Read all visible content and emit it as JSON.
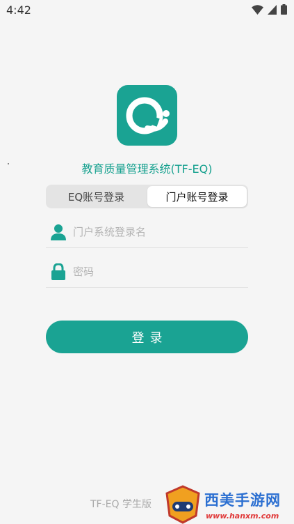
{
  "status_bar": {
    "time": "4:42"
  },
  "app": {
    "title": "教育质量管理系统(TF-EQ)",
    "logo_icon": "app-logo-q-icon",
    "brand_color": "#1aa393"
  },
  "tabs": {
    "eq_label": "EQ账号登录",
    "portal_label": "门户账号登录",
    "selected": "portal"
  },
  "form": {
    "username_placeholder": "门户系统登录名",
    "username_value": "",
    "password_placeholder": "密码",
    "password_value": "",
    "login_label": "登录"
  },
  "footer": {
    "version_text": "TF-EQ 学生版"
  },
  "watermark": {
    "title": "西美手游网",
    "url": "www.hanxm.com"
  }
}
